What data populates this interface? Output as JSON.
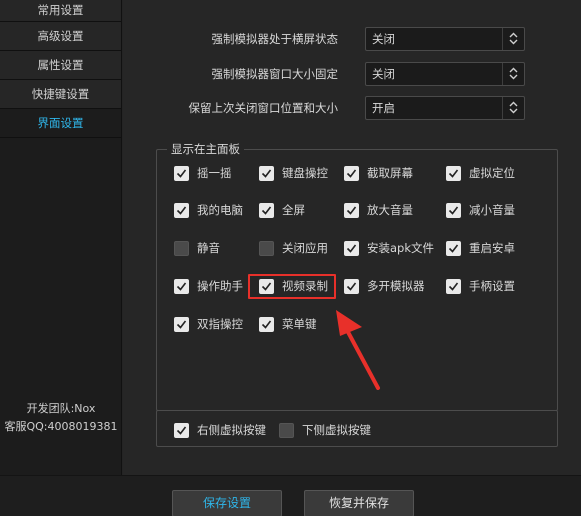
{
  "sidebar": {
    "items": [
      {
        "label": "常用设置"
      },
      {
        "label": "高级设置"
      },
      {
        "label": "属性设置"
      },
      {
        "label": "快捷键设置"
      },
      {
        "label": "界面设置"
      }
    ],
    "active_index": 4,
    "team_line": "开发团队:Nox",
    "support_line": "客服QQ:4008019381"
  },
  "settings": [
    {
      "label": "强制模拟器处于横屏状态",
      "value": "关闭"
    },
    {
      "label": "强制模拟器窗口大小固定",
      "value": "关闭"
    },
    {
      "label": "保留上次关闭窗口位置和大小",
      "value": "开启"
    }
  ],
  "main_panel": {
    "title": "显示在主面板",
    "items": [
      {
        "label": "摇一摇",
        "checked": true
      },
      {
        "label": "键盘操控",
        "checked": true
      },
      {
        "label": "截取屏幕",
        "checked": true
      },
      {
        "label": "虚拟定位",
        "checked": true
      },
      {
        "label": "我的电脑",
        "checked": true
      },
      {
        "label": "全屏",
        "checked": true
      },
      {
        "label": "放大音量",
        "checked": true
      },
      {
        "label": "减小音量",
        "checked": true
      },
      {
        "label": "静音",
        "checked": false
      },
      {
        "label": "关闭应用",
        "checked": false
      },
      {
        "label": "安装apk文件",
        "checked": true
      },
      {
        "label": "重启安卓",
        "checked": true
      },
      {
        "label": "操作助手",
        "checked": true
      },
      {
        "label": "视频录制",
        "checked": true
      },
      {
        "label": "多开模拟器",
        "checked": true
      },
      {
        "label": "手柄设置",
        "checked": true
      },
      {
        "label": "双指操控",
        "checked": true
      },
      {
        "label": "菜单键",
        "checked": true
      }
    ],
    "highlight_color": "#e8302a"
  },
  "virtual_keys": [
    {
      "label": "右侧虚拟按键",
      "checked": true
    },
    {
      "label": "下侧虚拟按键",
      "checked": false
    }
  ],
  "footer": {
    "save_label": "保存设置",
    "restore_label": "恢复并保存"
  },
  "colors": {
    "accent": "#2fb6ea",
    "annotation": "#e8302a"
  }
}
